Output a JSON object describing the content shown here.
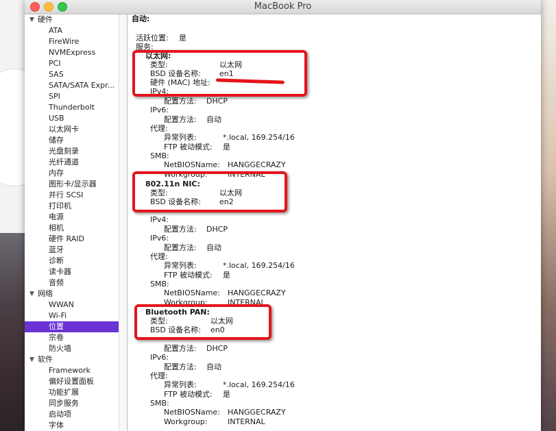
{
  "window": {
    "title": "MacBook Pro"
  },
  "sidebar": {
    "hardware": {
      "label": "硬件",
      "items": [
        "ATA",
        "FireWire",
        "NVMExpress",
        "PCI",
        "SAS",
        "SATA/SATA Expr...",
        "SPI",
        "Thunderbolt",
        "USB",
        "以太网卡",
        "储存",
        "光盘刻录",
        "光纤通道",
        "内存",
        "图形卡/显示器",
        "并行 SCSI",
        "打印机",
        "电源",
        "相机",
        "硬件 RAID",
        "蓝牙",
        "诊断",
        "读卡器",
        "音频"
      ]
    },
    "network": {
      "label": "网络",
      "items": [
        "WWAN",
        "Wi-Fi",
        "位置",
        "宗卷",
        "防火墙"
      ],
      "selected": "位置"
    },
    "software": {
      "label": "软件",
      "items": [
        "Framework",
        "偏好设置面板",
        "功能扩展",
        "同步服务",
        "启动项",
        "字体"
      ]
    }
  },
  "content": {
    "heading": "自动:",
    "active_location_label": "活跃位置:",
    "active_location_value": "是",
    "services_label": "服务:",
    "services": [
      {
        "name": "以太网:",
        "type_label": "类型:",
        "type_value": "以太网",
        "bsd_label": "BSD 设备名称:",
        "bsd_value": "en1",
        "mac_label": "硬件 (MAC) 地址:",
        "ipv4_label": "IPv4:",
        "ipv4_method_label": "配置方法:",
        "ipv4_method": "DHCP",
        "ipv6_label": "IPv6:",
        "ipv6_method_label": "配置方法:",
        "ipv6_method": "自动",
        "proxy_label": "代理:",
        "exceptions_label": "异常列表:",
        "exceptions_value": "*.local, 169.254/16",
        "ftp_label": "FTP 被动模式:",
        "ftp_value": "是",
        "smb_label": "SMB:",
        "netbios_label": "NetBIOSName:",
        "netbios_value": "HANGGECRAZY",
        "workgroup_label": "Workgroup:",
        "workgroup_value": "INTERNAL"
      },
      {
        "name": "802.11n NIC:",
        "type_label": "类型:",
        "type_value": "以太网",
        "bsd_label": "BSD 设备名称:",
        "bsd_value": "en2",
        "ipv4_label": "IPv4:",
        "ipv4_method_label": "配置方法:",
        "ipv4_method": "DHCP",
        "ipv6_label": "IPv6:",
        "ipv6_method_label": "配置方法:",
        "ipv6_method": "自动",
        "proxy_label": "代理:",
        "exceptions_label": "异常列表:",
        "exceptions_value": "*.local, 169.254/16",
        "ftp_label": "FTP 被动模式:",
        "ftp_value": "是",
        "smb_label": "SMB:",
        "netbios_label": "NetBIOSName:",
        "netbios_value": "HANGGECRAZY",
        "workgroup_label": "Workgroup:",
        "workgroup_value": "INTERNAL"
      },
      {
        "name": "Bluetooth PAN:",
        "type_label": "类型:",
        "type_value": "以太网",
        "bsd_label": "BSD 设备名称:",
        "bsd_value": "en0",
        "ipv6_label": "IPv6:",
        "ipv6_method_label": "配置方法:",
        "ipv6_method": "自动",
        "ipv4_method_label": "配置方法:",
        "ipv4_method": "DHCP",
        "proxy_label": "代理:",
        "exceptions_label": "异常列表:",
        "exceptions_value": "*.local, 169.254/16",
        "ftp_label": "FTP 被动模式:",
        "ftp_value": "是",
        "smb_label": "SMB:",
        "netbios_label": "NetBIOSName:",
        "netbios_value": "HANGGECRAZY",
        "workgroup_label": "Workgroup:",
        "workgroup_value": "INTERNAL"
      }
    ]
  },
  "colors": {
    "selection": "#6b33d6",
    "annotation": "#e5141b"
  }
}
